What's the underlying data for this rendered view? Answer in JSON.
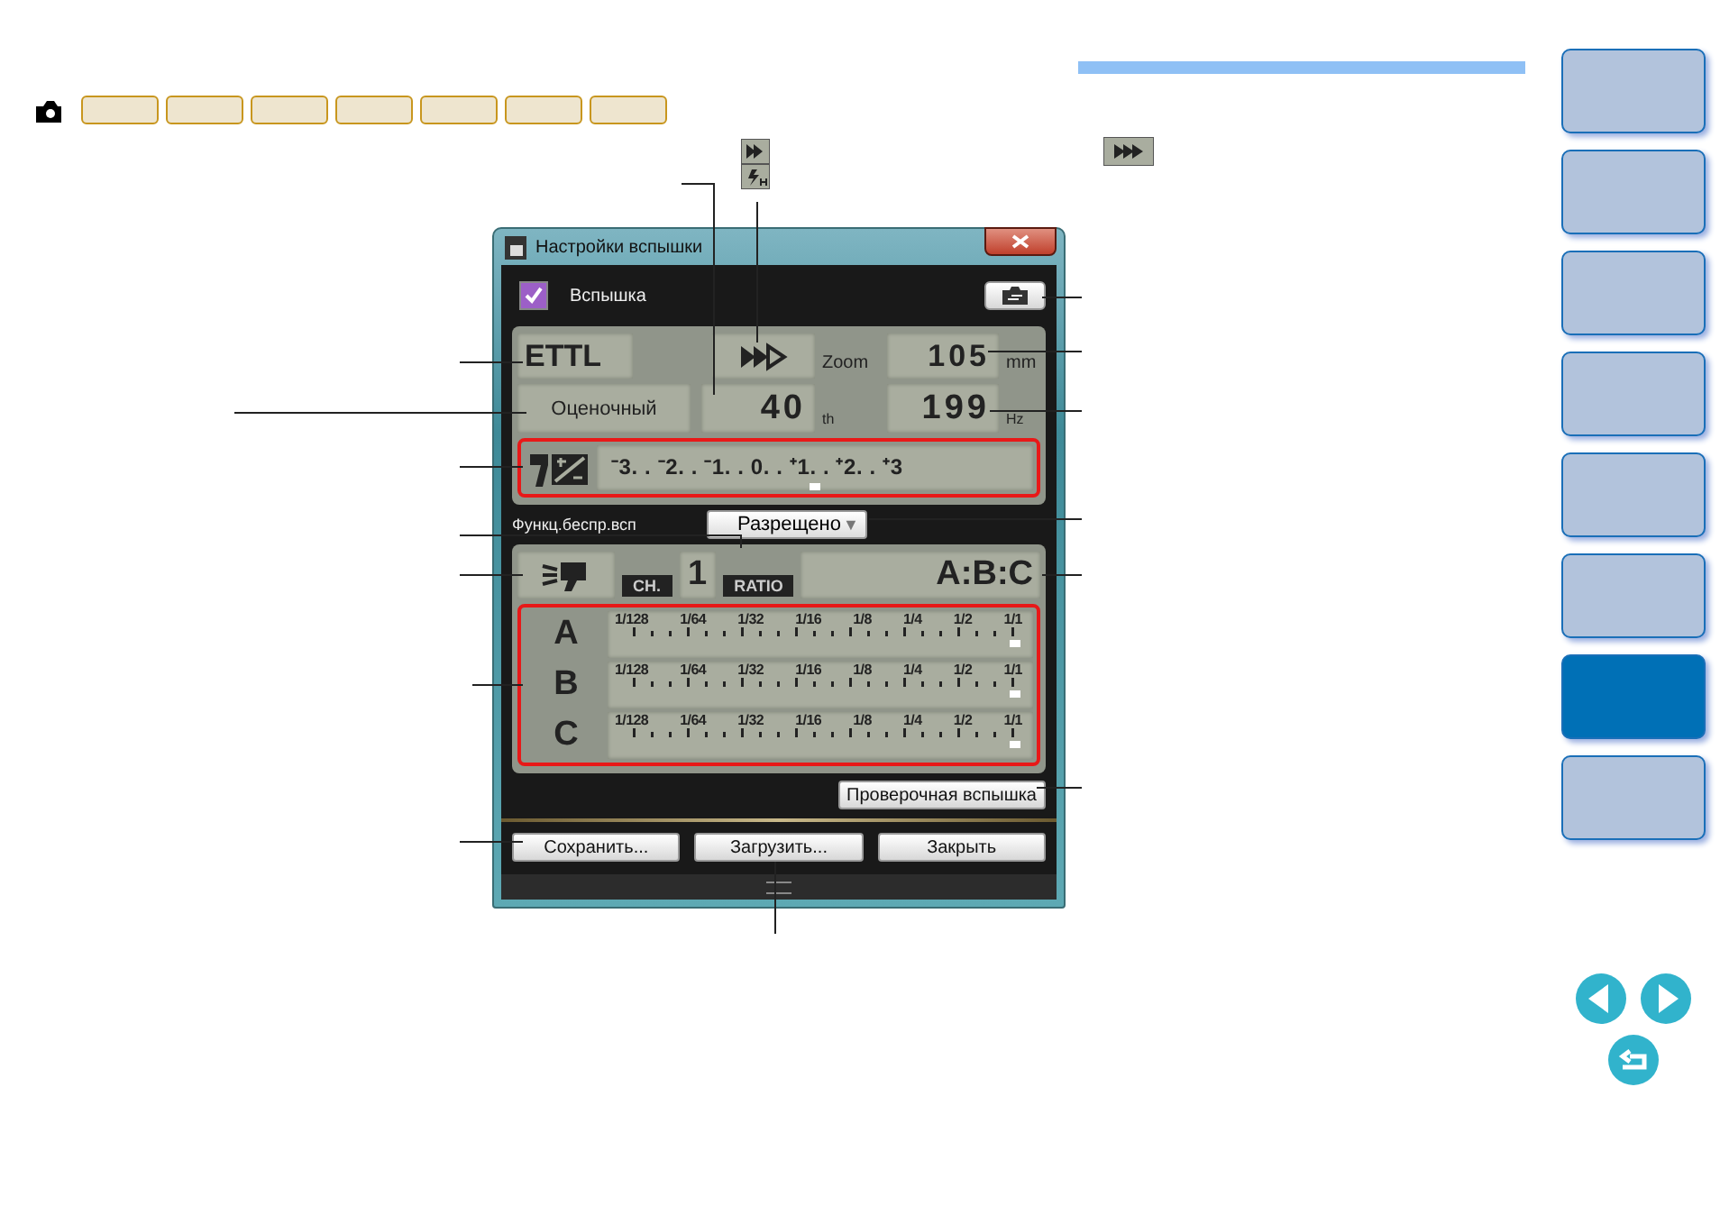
{
  "dialog": {
    "title": "Настройки вспышки",
    "flash": {
      "label": "Вспышка",
      "checked": true
    },
    "mode": "ETTL",
    "metering": "Оценочный",
    "zoom_label": "Zoom",
    "zoom": "105",
    "zoom_unit": "mm",
    "count": "40",
    "count_unit": "th",
    "frequency": "199",
    "frequency_unit": "Hz",
    "compensation": {
      "scale": "⁻3. . ⁻2. . ⁻1. . 0. . ⁺1. . ⁺2. . ⁺3",
      "level": 0.5
    },
    "wireless": {
      "label": "Функц.беспр.всп",
      "value": "Разрещено",
      "arrow": "▼"
    },
    "channel_label": "CH.",
    "channel": "1",
    "ratio_label": "RATIO",
    "ratio": "A:B:C",
    "groups": [
      {
        "name": "A",
        "scale": [
          "1/128",
          "1/64",
          "1/32",
          "1/16",
          "1/8",
          "1/4",
          "1/2",
          "1/1"
        ],
        "level": 1
      },
      {
        "name": "B",
        "scale": [
          "1/128",
          "1/64",
          "1/32",
          "1/16",
          "1/8",
          "1/4",
          "1/2",
          "1/1"
        ],
        "level": 1
      },
      {
        "name": "C",
        "scale": [
          "1/128",
          "1/64",
          "1/32",
          "1/16",
          "1/8",
          "1/4",
          "1/2",
          "1/1"
        ],
        "level": 1
      }
    ],
    "test_button": "Проверочная вспышка",
    "buttons": [
      "Сохранить...",
      "Загрузить...",
      "Закрыть"
    ]
  },
  "side_tabs": [
    {
      "selected": false
    },
    {
      "selected": false
    },
    {
      "selected": false
    },
    {
      "selected": false
    },
    {
      "selected": false
    },
    {
      "selected": false
    },
    {
      "selected": true
    },
    {
      "selected": false
    }
  ]
}
